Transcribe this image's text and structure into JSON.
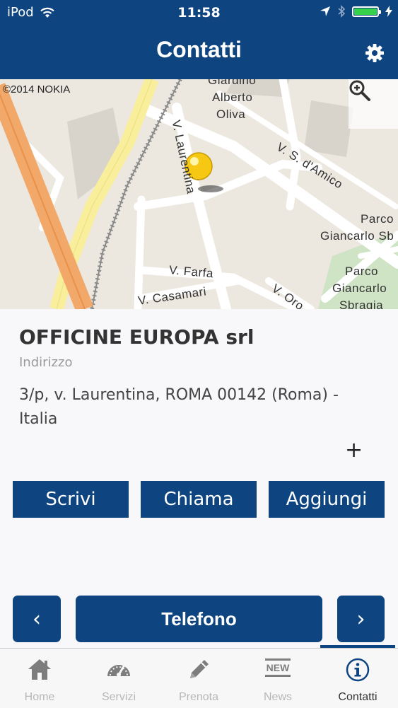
{
  "status_bar": {
    "carrier": "iPod",
    "time": "11:58"
  },
  "nav": {
    "title": "Contatti"
  },
  "map": {
    "copyright": "©2014 NOKIA",
    "labels": {
      "giardino": "Giardino",
      "alberto": "Alberto",
      "oliva": "Oliva",
      "v_damico": "V. S. d'Amico",
      "v_laurentina": "V. Laurentina",
      "parco1": "Parco",
      "giancarlo1": "Giancarlo Sb",
      "parco2": "Parco",
      "giancarlo2": "Giancarlo",
      "sbragia": "Sbragia",
      "v_farfa": "V. Farfa",
      "v_casamari": "V. Casamari",
      "v_oro": "V. Oro"
    }
  },
  "contact": {
    "company": "OFFICINE EUROPA srl",
    "address_label": "Indirizzo",
    "address": "3/p, v. Laurentina, ROMA 00142 (Roma) - Italia",
    "plus": "+"
  },
  "actions": {
    "write": "Scrivi",
    "call": "Chiama",
    "add": "Aggiungi"
  },
  "pager": {
    "prev": "‹",
    "title": "Telefono",
    "next": "›"
  },
  "tabs": [
    {
      "label": "Home",
      "icon": "home-icon"
    },
    {
      "label": "Servizi",
      "icon": "gauge-icon"
    },
    {
      "label": "Prenota",
      "icon": "pencil-icon"
    },
    {
      "label": "News",
      "icon": "news-icon"
    },
    {
      "label": "Contatti",
      "icon": "info-icon"
    }
  ],
  "colors": {
    "brand": "#0e4581",
    "battery": "#35d24a"
  }
}
